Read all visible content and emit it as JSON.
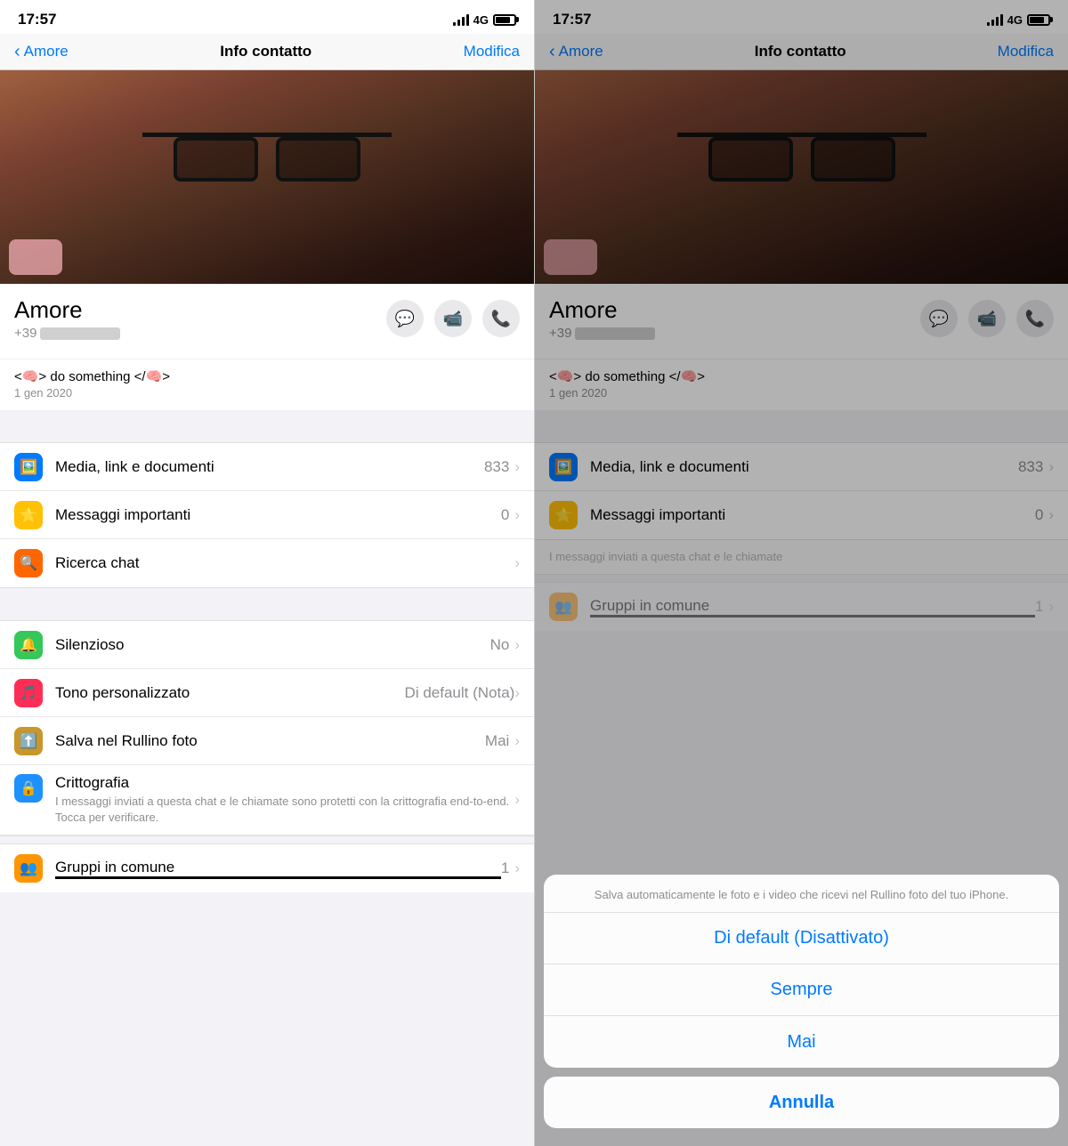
{
  "panels": [
    {
      "id": "left",
      "statusBar": {
        "time": "17:57",
        "networkType": "4G"
      },
      "navBar": {
        "backLabel": "Amore",
        "title": "Info contatto",
        "editLabel": "Modifica"
      },
      "contactName": "Amore",
      "contactPhone": "+39",
      "actionButtons": [
        {
          "icon": "💬",
          "label": "Messaggio"
        },
        {
          "icon": "📹",
          "label": "Video"
        },
        {
          "icon": "📞",
          "label": "Telefono"
        }
      ],
      "statusMessage": "<🧠> do something </🧠>",
      "statusDate": "1 gen 2020",
      "menuSections": [
        {
          "items": [
            {
              "icon": "🖼️",
              "iconBg": "blue",
              "label": "Media, link e documenti",
              "value": "833",
              "hasChevron": true
            },
            {
              "icon": "⭐",
              "iconBg": "yellow",
              "label": "Messaggi importanti",
              "value": "0",
              "hasChevron": true
            },
            {
              "icon": "🔍",
              "iconBg": "orange",
              "label": "Ricerca chat",
              "value": "",
              "hasChevron": true
            }
          ]
        },
        {
          "items": [
            {
              "icon": "🔔",
              "iconBg": "green",
              "label": "Silenzioso",
              "value": "No",
              "hasChevron": true
            },
            {
              "icon": "🎵",
              "iconBg": "pink",
              "label": "Tono personalizzato",
              "labelDetail": "Di default (Nota)",
              "value": "",
              "hasChevron": true
            },
            {
              "icon": "⬆️",
              "iconBg": "gold",
              "label": "Salva nel Rullino foto",
              "value": "Mai",
              "hasChevron": true
            },
            {
              "icon": "🔒",
              "iconBg": "blue2",
              "label": "Crittografia",
              "sub": "I messaggi inviati a questa chat e le chiamate sono protetti con la crittografia end-to-end. Tocca per verificare.",
              "value": "",
              "hasChevron": true,
              "isMulti": true
            }
          ]
        }
      ],
      "groupsItem": {
        "icon": "👥",
        "iconBg": "orange2",
        "label": "Gruppi in comune",
        "value": "1",
        "hasChevron": true
      }
    },
    {
      "id": "right",
      "statusBar": {
        "time": "17:57",
        "networkType": "4G"
      },
      "navBar": {
        "backLabel": "Amore",
        "title": "Info contatto",
        "editLabel": "Modifica"
      },
      "contactName": "Amore",
      "contactPhone": "+39",
      "actionButtons": [
        {
          "icon": "💬",
          "label": "Messaggio"
        },
        {
          "icon": "📹",
          "label": "Video"
        },
        {
          "icon": "📞",
          "label": "Telefono"
        }
      ],
      "statusMessage": "<🧠> do something </🧠>",
      "statusDate": "1 gen 2020",
      "menuSections": [
        {
          "items": [
            {
              "icon": "🖼️",
              "iconBg": "blue",
              "label": "Media, link e documenti",
              "value": "833",
              "hasChevron": true
            },
            {
              "icon": "⭐",
              "iconBg": "yellow",
              "label": "Messaggi importanti",
              "value": "0",
              "hasChevron": true
            }
          ]
        }
      ],
      "actionSheet": {
        "headerText": "Salva automaticamente le foto e i video che ricevi nel Rullino foto del tuo iPhone.",
        "options": [
          {
            "label": "Di default (Disattivato)",
            "id": "default"
          },
          {
            "label": "Sempre",
            "id": "always"
          },
          {
            "label": "Mai",
            "id": "never"
          }
        ],
        "cancelLabel": "Annulla"
      },
      "groupsItem": {
        "icon": "👥",
        "iconBg": "orange2",
        "label": "Gruppi in comune",
        "value": "1",
        "hasChevron": true
      }
    }
  ]
}
